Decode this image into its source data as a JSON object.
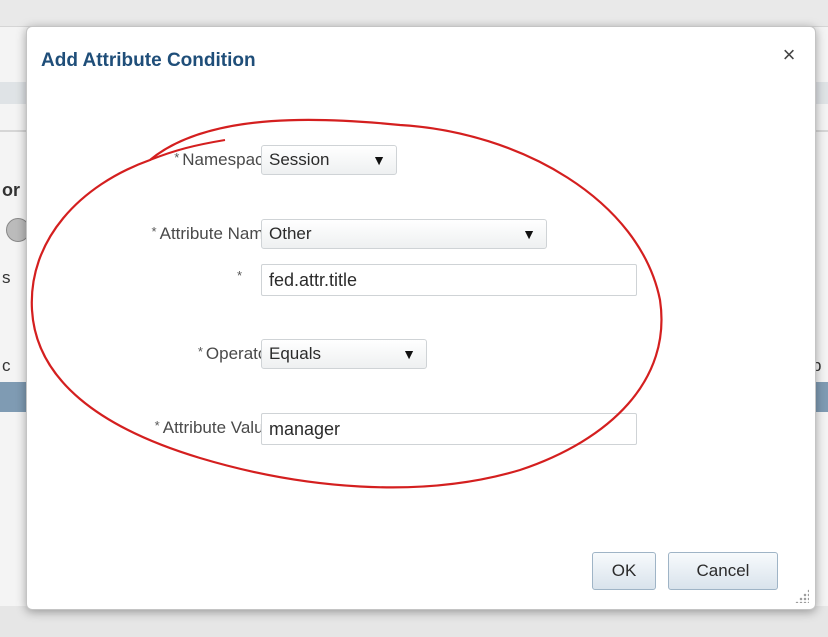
{
  "background": {
    "fragments": [
      "or",
      "c",
      "p",
      "s"
    ]
  },
  "dialog": {
    "title": "Add Attribute Condition",
    "close_symbol": "×",
    "required_marker": "*",
    "fields": {
      "namespace": {
        "label": "Namespace",
        "value": "Session"
      },
      "attribute_name": {
        "label": "Attribute Name",
        "value": "Other"
      },
      "attribute_name_custom": {
        "value": "fed.attr.title"
      },
      "operator": {
        "label": "Operator",
        "value": "Equals"
      },
      "attribute_value": {
        "label": "Attribute Value",
        "value": "manager"
      }
    },
    "buttons": {
      "ok": "OK",
      "cancel": "Cancel"
    }
  },
  "annotation": {
    "color": "#d41f1f",
    "shape": "ellipse"
  },
  "colors": {
    "title": "#1f4e79",
    "button_border": "#9fb4c6"
  }
}
